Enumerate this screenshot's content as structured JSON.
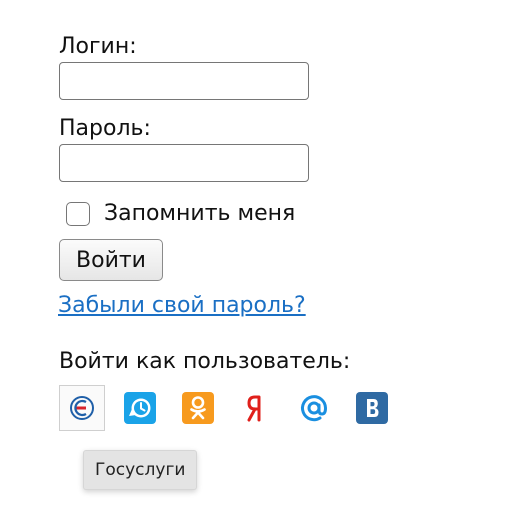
{
  "form": {
    "login_label": "Логин:",
    "login_value": "",
    "password_label": "Пароль:",
    "password_value": "",
    "remember_label": "Запомнить меня",
    "remember_checked": false,
    "submit_label": "Войти",
    "forgot_link": "Забыли свой пароль?"
  },
  "social": {
    "heading": "Войти как пользователь:",
    "providers": [
      {
        "name": "gosuslugi",
        "icon": "gosuslugi-icon",
        "selected": true
      },
      {
        "name": "livejournal",
        "icon": "livejournal-icon",
        "selected": false
      },
      {
        "name": "odnoklassniki",
        "icon": "odnoklassniki-icon",
        "selected": false
      },
      {
        "name": "yandex",
        "icon": "yandex-icon",
        "selected": false
      },
      {
        "name": "mailru",
        "icon": "mailru-icon",
        "selected": false
      },
      {
        "name": "vkontakte",
        "icon": "vkontakte-icon",
        "selected": false
      }
    ],
    "tooltip": "Госуслуги"
  },
  "colors": {
    "link": "#1a6fc4",
    "livejournal": "#1aa3e8",
    "odnoklassniki": "#f79a1e",
    "yandex": "#e0201b",
    "mailru": "#1a8fe0",
    "vkontakte": "#2f6aa3",
    "gosuslugi_blue": "#1f5fa8",
    "gosuslugi_red": "#d8232a"
  }
}
